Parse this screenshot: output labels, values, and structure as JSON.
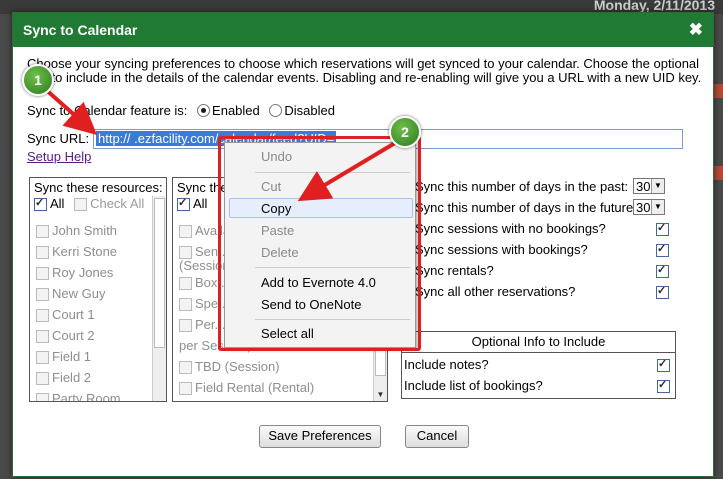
{
  "background": {
    "date_text": "Monday, 2/11/2013"
  },
  "dialog": {
    "title": "Sync to Calendar",
    "close_glyph": "✖",
    "intro": "Choose your syncing preferences to choose which reservations will get synced to your calendar. Choose the optional info to include in the details of the calendar events. Disabling and re-enabling will give you a URL with a new UID key.",
    "feature_label": "Sync to Calendar feature is:",
    "enabled_label": "Enabled",
    "disabled_label": "Disabled",
    "enabled_selected": true,
    "url_label": "Sync URL:",
    "url_value": "http://         .ezfacility.com/calendar/feed?UID=",
    "setup_help": "Setup Help"
  },
  "resources_panel": {
    "header": "Sync these resources:",
    "all_label": "All",
    "check_all_label": "Check All",
    "items": [
      "John Smith",
      "Kerri Stone",
      "Roy Jones",
      "New Guy",
      "Court 1",
      "Court 2",
      "Field 1",
      "Field 2",
      "Party Room"
    ]
  },
  "types_panel": {
    "header": "Sync these",
    "all_label": "All",
    "items": [
      "Available",
      "Sen...",
      "(Session)",
      "Box...",
      "Spe...",
      "Per...",
      "per Session)",
      "TBD (Session)",
      "Field Rental (Rental)"
    ]
  },
  "options": [
    {
      "label": "Sync this number of days in the past:",
      "value": "30"
    },
    {
      "label": "Sync this number of days in the future:",
      "value": "30"
    },
    {
      "label": "Sync sessions with no bookings?",
      "checked": true
    },
    {
      "label": "Sync sessions with bookings?",
      "checked": true
    },
    {
      "label": "Sync rentals?",
      "checked": true
    },
    {
      "label": "Sync all other reservations?",
      "checked": true
    }
  ],
  "optional_info": {
    "header": "Optional Info to Include",
    "items": [
      {
        "label": "Include notes?",
        "checked": true
      },
      {
        "label": "Include list of bookings?",
        "checked": true
      }
    ]
  },
  "buttons": {
    "save": "Save Preferences",
    "cancel": "Cancel"
  },
  "context_menu": {
    "undo": "Undo",
    "cut": "Cut",
    "copy": "Copy",
    "paste": "Paste",
    "delete": "Delete",
    "evernote": "Add to Evernote 4.0",
    "onenote": "Send to OneNote",
    "select_all": "Select all"
  },
  "callouts": {
    "one": "1",
    "two": "2"
  },
  "colors": {
    "title_bar": "#217a33",
    "highlight_red": "#e02020",
    "badge_green": "#3f9a2a",
    "link": "#5a1a8a"
  }
}
